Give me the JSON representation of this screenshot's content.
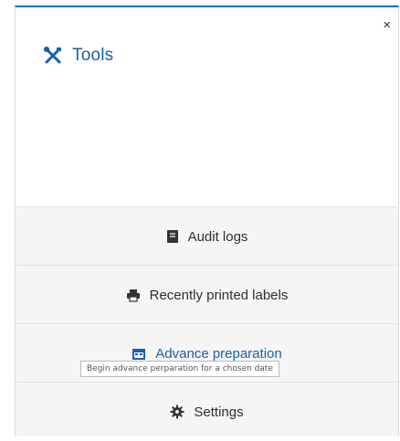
{
  "panel": {
    "title": "Tools",
    "close_glyph": "×",
    "title_icon": "tools-icon"
  },
  "items": [
    {
      "label": "Audit logs",
      "icon": "book-icon"
    },
    {
      "label": "Recently printed labels",
      "icon": "printer-icon"
    },
    {
      "label": "Advance preparation",
      "icon": "calendar-icon"
    },
    {
      "label": "Settings",
      "icon": "gear-icon"
    }
  ],
  "tooltip": {
    "text": "Begin advance perparation for a chosen date"
  },
  "colors": {
    "accent": "#1a5fa8",
    "top_border": "#1a6fc4",
    "list_bg": "#f5f5f5"
  }
}
